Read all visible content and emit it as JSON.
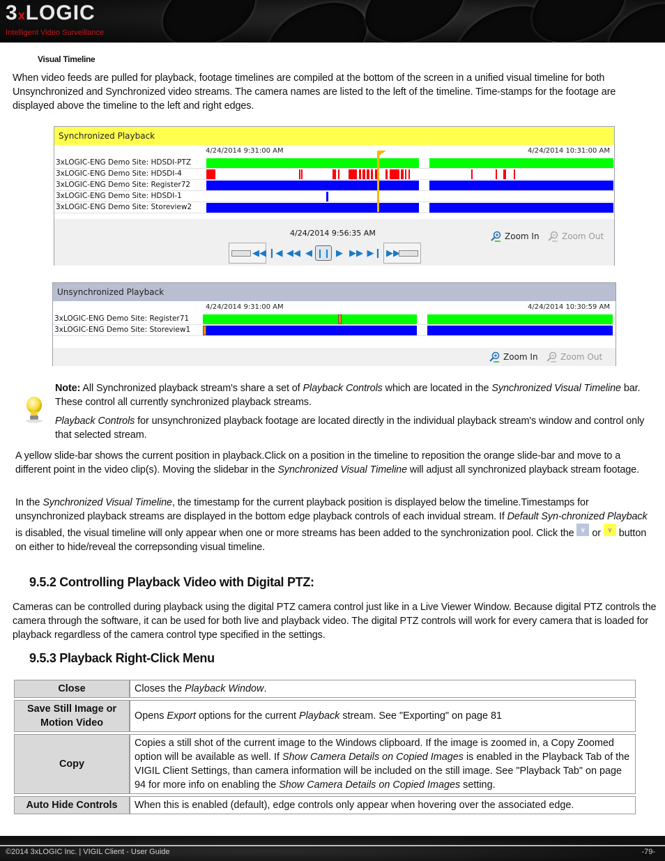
{
  "header": {
    "logo_main_a": "3",
    "logo_main_x": "x",
    "logo_main_b": "LOGIC",
    "logo_sub": "Intelligent Video Surveillance"
  },
  "section_subhead": "Visual Timeline",
  "intro_paragraph": "When video feeds are pulled for playback, footage timelines are compiled at the bottom of the screen in a unified visual timeline for both Unsynchronized and Synchronized video streams. The camera names are listed to the left of the timeline. Time-stamps for the footage are displayed above the timeline to the left and right edges.",
  "sync_panel": {
    "title": "Synchronized Playback",
    "collapse_icon": "double-chevron-down",
    "start_time": "4/24/2014 9:31:00 AM",
    "end_time": "4/24/2014 10:31:00 AM",
    "current_time": "4/24/2014 9:56:35 AM",
    "slider_position": 0.42,
    "cameras": [
      {
        "name": "3xLOGIC-ENG Demo Site: HDSDI-PTZ",
        "color": "#00ff00"
      },
      {
        "name": "3xLOGIC-ENG Demo Site: HDSDI-4",
        "color": "#ff0000"
      },
      {
        "name": "3xLOGIC-ENG Demo Site: Register72",
        "color": "#0000ff"
      },
      {
        "name": "3xLOGIC-ENG Demo Site: HDSDI-1",
        "color": "#0000ff"
      },
      {
        "name": "3xLOGIC-ENG Demo Site: Storeview2",
        "color": "#0000ff"
      }
    ],
    "zoom_in": "Zoom In",
    "zoom_out": "Zoom Out",
    "controls": [
      "slow-rewind",
      "skip-to-start",
      "rewind",
      "step-back",
      "pause",
      "play",
      "fast-forward",
      "skip-to-end",
      "slow-forward"
    ]
  },
  "unsync_panel": {
    "title": "Unsynchronized Playback",
    "collapse_icon": "double-chevron-down",
    "start_time": "4/24/2014 9:31:00 AM",
    "end_time": "4/24/2014 10:30:59 AM",
    "cameras": [
      {
        "name": "3xLOGIC-ENG Demo Site: Register71",
        "color": "#00ff00",
        "marker_position": 0.33
      },
      {
        "name": "3xLOGIC-ENG Demo Site: Storeview1",
        "color": "#0000ff",
        "marker_position": 0.0
      }
    ],
    "zoom_in": "Zoom In",
    "zoom_out": "Zoom Out"
  },
  "note": {
    "label": "Note:",
    "p1_a": " All Synchronized playback stream's share a set of ",
    "p1_b": "Playback Controls",
    "p1_c": " which are located in the ",
    "p1_d": "Synchronized Visual Timeline",
    "p1_e": " bar. These control all currently synchronized playback streams.",
    "p2_a": "Playback Controls",
    "p2_b": " for unsynchronized playback footage are located directly in the individual playback stream's window and control only that selected stream."
  },
  "para_slidebar": {
    "a": "A yellow slide-bar shows the current position in playback.Click on a position in the timeline to reposition the orange slide-bar and move to a different point in the video clip(s). Moving the slidebar in the ",
    "b": "Synchronized Visual Timeline",
    "c": " will adjust all synchronized playback stream footage."
  },
  "para_timestamp": {
    "a": "In the ",
    "b": "Synchronized Visual Timeline",
    "c": ", the timestamp for the current playback position is displayed below the timeline.Timestamps for unsynchronized playback streams are displayed in the bottom edge playback controls of each invidual stream. If ",
    "d": "Default Syn-chronized Playback",
    "e": " is disabled, the visual timeline will only appear when one or more streams has been added to the synchronization pool. Click the ",
    "f": " or ",
    "g": " button on either to hide/reveal the correpsonding visual timeline."
  },
  "section_952": {
    "heading": "9.5.2 Controlling Playback Video with Digital PTZ:",
    "body": "Cameras can be controlled during playback using the digital PTZ camera control just like in a Live Viewer Window. Because digital PTZ controls the camera through the software, it can be used for both live and playback video. The digital PTZ controls will work for every camera that is loaded for playback regardless of the camera control type specified in the settings."
  },
  "section_953": {
    "heading": "9.5.3 Playback Right-Click Menu",
    "rows": [
      {
        "key": "Close",
        "v_a": "Closes the ",
        "v_b": "Playback Window",
        "v_c": "."
      },
      {
        "key": "Save Still Image or Motion Video",
        "v_a": "Opens ",
        "v_b": "Export",
        "v_c": " options for the current ",
        "v_d": "Playback",
        "v_e": " stream. See \"Exporting\" on page 81"
      },
      {
        "key": "Copy",
        "v_a": "Copies a still shot of the current image to the Windows clipboard.  If the image is zoomed in, a Copy Zoomed option will be available as well. If ",
        "v_b": "Show Camera Details on Copied Images",
        "v_c": " is enabled in the Playback Tab of the VIGIL Client Settings, than camera information will be included on the still image. See \"Playback Tab\" on page 94 for more info on enabling the ",
        "v_d": "Show Camera Details on Copied Images",
        "v_e": " setting."
      },
      {
        "key": "Auto Hide Controls",
        "v_a": "When this is enabled (default), edge controls only appear when hovering over the associated edge."
      }
    ]
  },
  "footer": {
    "left": "©2014 3xLOGIC Inc.  |  VIGIL Client - User Guide",
    "right": "-79-"
  },
  "colors": {
    "sync_title_bg": "#ffff4d",
    "unsync_title_bg": "#b9bfd1",
    "green": "#00ff00",
    "red": "#ff0000",
    "blue": "#0000ff",
    "slider": "#f5b800",
    "marker": "#ff8c00"
  }
}
